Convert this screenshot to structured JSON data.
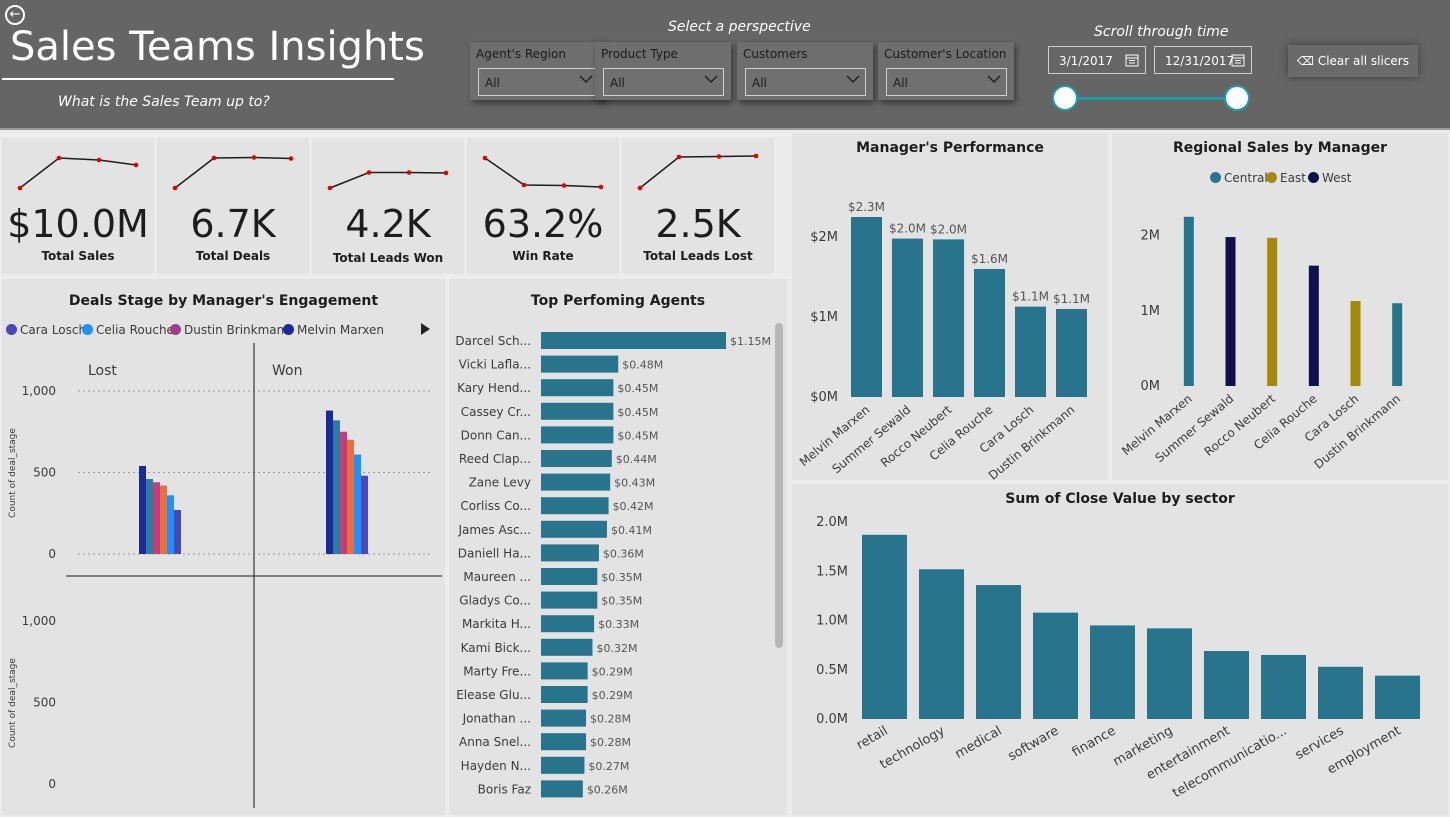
{
  "header": {
    "back_icon": "arrow-left-circle-icon",
    "title": "Sales Teams Insights",
    "subtitle": "What is the Sales Team up to?",
    "perspective_label": "Select a perspective",
    "time_label": "Scroll through time",
    "clear_label": "Clear all slicers",
    "clear_icon": "eraser-icon",
    "start_date": "3/1/2017",
    "end_date": "12/31/2017",
    "slicers": [
      {
        "label": "Agent's Region",
        "value": "All"
      },
      {
        "label": "Product Type",
        "value": "All"
      },
      {
        "label": "Customers",
        "value": "All"
      },
      {
        "label": "Customer's Location",
        "value": "All"
      }
    ]
  },
  "kpis": [
    {
      "value": "$10.0M",
      "label": "Total Sales",
      "trend": [
        1,
        4,
        3.8,
        3.3
      ]
    },
    {
      "value": "6.7K",
      "label": "Total Deals",
      "trend": [
        1,
        4,
        4.05,
        3.95
      ]
    },
    {
      "value": "4.2K",
      "label": "Total Leads Won",
      "trend": [
        1,
        2.55,
        2.55,
        2.5
      ]
    },
    {
      "value": "63.2%",
      "label": "Win Rate",
      "trend": [
        4,
        1.3,
        1.25,
        1.1
      ]
    },
    {
      "value": "2.5K",
      "label": "Total Leads Lost",
      "trend": [
        1,
        4.1,
        4.15,
        4.2
      ]
    }
  ],
  "colors": {
    "teal": "#27748c",
    "central": "#27748c",
    "east": "#a58a0a",
    "west": "#10104e",
    "trend_line": "#1d1d1d",
    "trend_dot": "#e00000"
  },
  "chart_data": [
    {
      "type": "bar",
      "id": "deals-stage",
      "title": "Deals Stage by Manager's Engagement",
      "ylabel": "Count of deal_stage",
      "ylim": [
        0,
        1000
      ],
      "yticks": [
        "0",
        "500",
        "1,000"
      ],
      "facets": [
        "Lost",
        "Won"
      ],
      "legend": [
        "Cara Losch",
        "Celia Rouche",
        "Dustin Brinkmann",
        "Melvin Marxen"
      ],
      "series": [
        {
          "name": "Melvin Marxen",
          "color": "#1a2a9a",
          "values": [
            540,
            880
          ]
        },
        {
          "name": "",
          "color": "#2b7ca0",
          "values": [
            460,
            820
          ]
        },
        {
          "name": "",
          "color": "#c23d7a",
          "values": [
            440,
            750
          ]
        },
        {
          "name": "",
          "color": "#e8703a",
          "values": [
            420,
            700
          ]
        },
        {
          "name": "Celia Rouche",
          "color": "#1e90ff",
          "values": [
            360,
            610
          ]
        },
        {
          "name": "Cara Losch",
          "color": "#4a48b8",
          "values": [
            270,
            480
          ]
        }
      ],
      "legend_colors": [
        "#4a48b8",
        "#1e90ff",
        "#a03c8a",
        "#1a2a9a"
      ],
      "lower_yticks": [
        "0",
        "500",
        "1,000"
      ]
    },
    {
      "type": "bar",
      "id": "top-agents",
      "title": "Top Perfoming Agents",
      "orientation": "horizontal",
      "categories": [
        "Darcel Sch...",
        "Vicki Lafla...",
        "Kary Hend...",
        "Cassey Cr...",
        "Donn Can...",
        "Reed Clap...",
        "Zane Levy",
        "Corliss Co...",
        "James Asc...",
        "Daniell Ha...",
        "Maureen ...",
        "Gladys Co...",
        "Markita H...",
        "Kami Bick...",
        "Marty Fre...",
        "Elease Glu...",
        "Jonathan ...",
        "Anna Snel...",
        "Hayden N...",
        "Boris Faz"
      ],
      "values": [
        1.15,
        0.48,
        0.45,
        0.45,
        0.45,
        0.44,
        0.43,
        0.42,
        0.41,
        0.36,
        0.35,
        0.35,
        0.33,
        0.32,
        0.29,
        0.29,
        0.28,
        0.28,
        0.27,
        0.26
      ],
      "labels": [
        "$1.15M",
        "$0.48M",
        "$0.45M",
        "$0.45M",
        "$0.45M",
        "$0.44M",
        "$0.43M",
        "$0.42M",
        "$0.41M",
        "$0.36M",
        "$0.35M",
        "$0.35M",
        "$0.33M",
        "$0.32M",
        "$0.29M",
        "$0.29M",
        "$0.28M",
        "$0.28M",
        "$0.27M",
        "$0.26M"
      ]
    },
    {
      "type": "bar",
      "id": "manager-performance",
      "title": "Manager's Performance",
      "categories": [
        "Melvin Marxen",
        "Summer Sewald",
        "Rocco Neubert",
        "Celia Rouche",
        "Cara Losch",
        "Dustin Brinkmann"
      ],
      "values": [
        2.25,
        1.98,
        1.97,
        1.6,
        1.13,
        1.1
      ],
      "labels": [
        "$2.3M",
        "$2.0M",
        "$2.0M",
        "$1.6M",
        "$1.1M",
        "$1.1M"
      ],
      "ylim": [
        0,
        2.2
      ],
      "yticks": [
        {
          "v": 0,
          "t": "$0M"
        },
        {
          "v": 1,
          "t": "$1M"
        },
        {
          "v": 2,
          "t": "$2M"
        }
      ]
    },
    {
      "type": "bar",
      "id": "regional-sales",
      "title": "Regional Sales by Manager",
      "categories": [
        "Melvin Marxen",
        "Summer Sewald",
        "Rocco Neubert",
        "Celia Rouche",
        "Cara Losch",
        "Dustin Brinkmann"
      ],
      "legend": [
        "Central",
        "East",
        "West"
      ],
      "series": [
        {
          "name": "Central",
          "values": [
            2.25,
            0,
            0,
            0,
            0,
            1.1
          ]
        },
        {
          "name": "East",
          "values": [
            0,
            0,
            1.97,
            0,
            1.13,
            0
          ]
        },
        {
          "name": "West",
          "values": [
            0,
            1.98,
            0,
            1.6,
            0,
            0
          ]
        }
      ],
      "ylim": [
        0,
        2.3
      ],
      "yticks": [
        {
          "v": 0,
          "t": "0M"
        },
        {
          "v": 1,
          "t": "1M"
        },
        {
          "v": 2,
          "t": "2M"
        }
      ]
    },
    {
      "type": "bar",
      "id": "close-value-sector",
      "title": "Sum of Close Value by sector",
      "categories": [
        "retail",
        "technology",
        "medical",
        "software",
        "finance",
        "marketing",
        "entertainment",
        "telecommunicatio...",
        "services",
        "employment"
      ],
      "values": [
        1.87,
        1.52,
        1.36,
        1.08,
        0.95,
        0.92,
        0.69,
        0.65,
        0.53,
        0.44
      ],
      "ylim": [
        0,
        2.0
      ],
      "yticks": [
        {
          "v": 0,
          "t": "0.0M"
        },
        {
          "v": 0.5,
          "t": "0.5M"
        },
        {
          "v": 1.0,
          "t": "1.0M"
        },
        {
          "v": 1.5,
          "t": "1.5M"
        },
        {
          "v": 2.0,
          "t": "2.0M"
        }
      ]
    }
  ]
}
